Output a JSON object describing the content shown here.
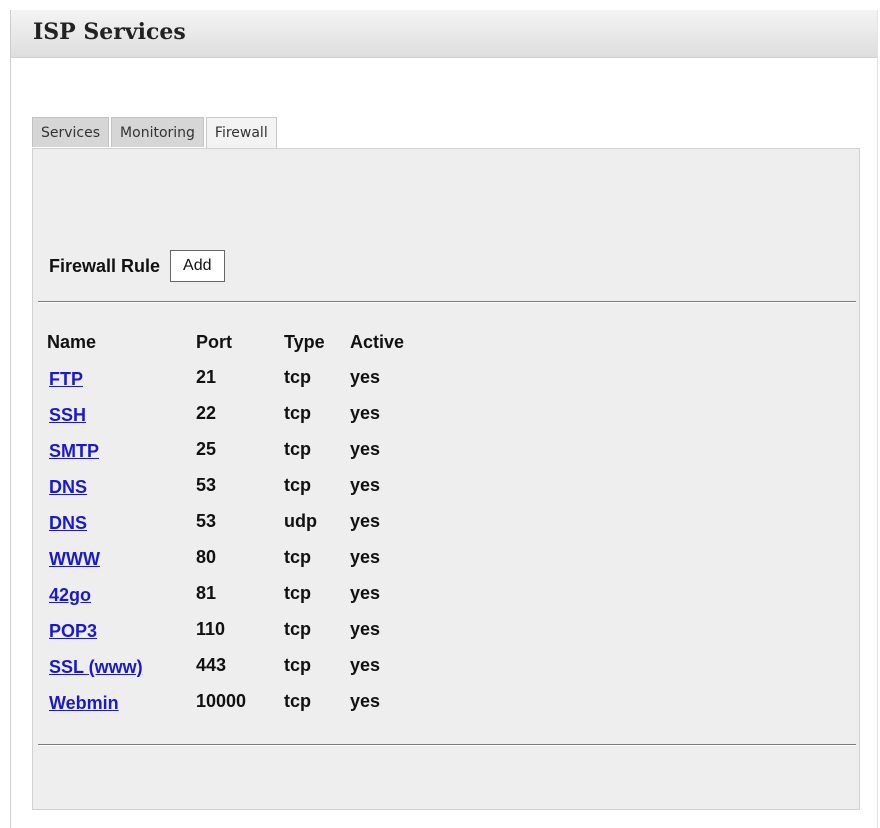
{
  "panel": {
    "title": "ISP Services"
  },
  "tabs": [
    {
      "label": "Services",
      "active": false
    },
    {
      "label": "Monitoring",
      "active": false
    },
    {
      "label": "Firewall",
      "active": true
    }
  ],
  "firewall": {
    "rule_label": "Firewall Rule",
    "add_label": "Add",
    "columns": [
      "Name",
      "Port",
      "Type",
      "Active"
    ],
    "rows": [
      {
        "name": "FTP",
        "port": "21",
        "type": "tcp",
        "active": "yes"
      },
      {
        "name": "SSH",
        "port": "22",
        "type": "tcp",
        "active": "yes"
      },
      {
        "name": "SMTP",
        "port": "25",
        "type": "tcp",
        "active": "yes"
      },
      {
        "name": "DNS",
        "port": "53",
        "type": "tcp",
        "active": "yes"
      },
      {
        "name": "DNS",
        "port": "53",
        "type": "udp",
        "active": "yes"
      },
      {
        "name": "WWW",
        "port": "80",
        "type": "tcp",
        "active": "yes"
      },
      {
        "name": "42go",
        "port": "81",
        "type": "tcp",
        "active": "yes"
      },
      {
        "name": "POP3",
        "port": "110",
        "type": "tcp",
        "active": "yes"
      },
      {
        "name": "SSL (www)",
        "port": "443",
        "type": "tcp",
        "active": "yes"
      },
      {
        "name": "Webmin",
        "port": "10000",
        "type": "tcp",
        "active": "yes"
      }
    ]
  },
  "colors": {
    "link": "#1a1acc",
    "tab_panel_bg": "#eeeeee",
    "header_gradient_top": "#f4f4f4"
  }
}
